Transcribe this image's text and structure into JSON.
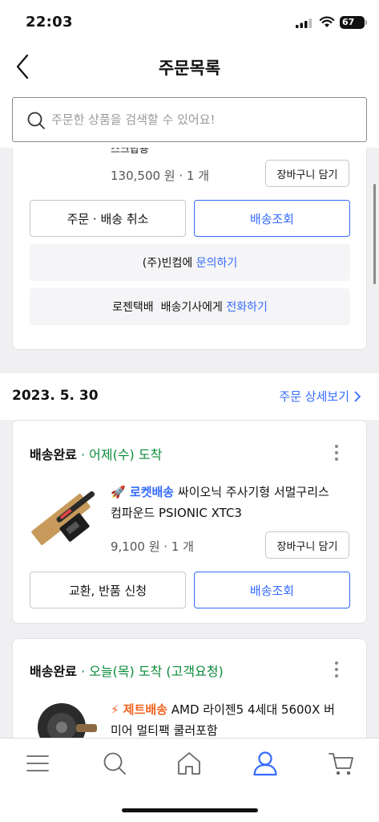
{
  "status_bar": {
    "time": "22:03",
    "battery": "67"
  },
  "header": {
    "title": "주문목록"
  },
  "search": {
    "placeholder": "주문한 상품을 검색할 수 있어요!"
  },
  "order_prev": {
    "item_name_tail": "스크탑용",
    "price_qty": "130,500 원 · 1 개",
    "cart_label": "장바구니 담기",
    "cancel_label": "주문 · 배송 취소",
    "track_label": "배송조회",
    "seller_prefix": "(주)빈컴에",
    "seller_link": "문의하기",
    "courier_prefix": "로젠택배  배송기사에게",
    "courier_link": "전화하기"
  },
  "order_group": {
    "date": "2023. 5. 30",
    "detail_link": "주문 상세보기"
  },
  "order_1": {
    "status": "배송완료",
    "arrival": "어제(수) 도착",
    "badge": "로켓배송",
    "name_line1": "싸이오닉 주사기형 서멀구리스",
    "name_line2": "컴파운드 PSIONIC XTC3",
    "price_qty": "9,100 원 · 1 개",
    "cart_label": "장바구니 담기",
    "return_label": "교환, 반품 신청",
    "track_label": "배송조회"
  },
  "order_2": {
    "status": "배송완료",
    "arrival": "오늘(목) 도착 (고객요청)",
    "badge": "제트배송",
    "name_line1": "AMD 라이젠5 4세대 5600X 버",
    "name_line2": "미어 멀티팩 쿨러포함"
  },
  "icons": {
    "back": "chevron-left-icon",
    "search": "search-icon",
    "more": "more-vertical-icon",
    "tab_menu": "menu-icon",
    "tab_search": "search-icon",
    "tab_home": "home-icon",
    "tab_my": "user-icon",
    "tab_cart": "cart-icon"
  },
  "colors": {
    "accent_blue": "#346aff",
    "status_green": "#0a8a3a",
    "jet_orange": "#f26522",
    "active_tab": "#346aff"
  }
}
